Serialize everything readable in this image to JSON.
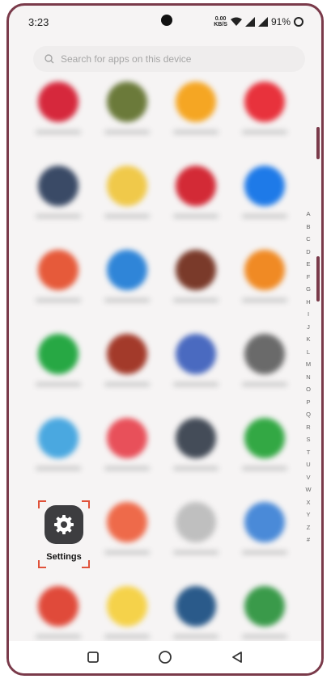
{
  "status_bar": {
    "time": "3:23",
    "net_speed_value": "0.00",
    "net_speed_unit": "KB/S",
    "battery": "91%"
  },
  "search": {
    "placeholder": "Search for apps on this device"
  },
  "settings_app": {
    "label": "Settings"
  },
  "alphabet_index": [
    "A",
    "B",
    "C",
    "D",
    "E",
    "F",
    "G",
    "H",
    "I",
    "J",
    "K",
    "L",
    "M",
    "N",
    "O",
    "P",
    "Q",
    "R",
    "S",
    "T",
    "U",
    "V",
    "W",
    "X",
    "Y",
    "Z",
    "#"
  ],
  "blurred_apps": [
    {
      "color": "#d6283c"
    },
    {
      "color": "#6b7a3a"
    },
    {
      "color": "#f5a623"
    },
    {
      "color": "#e8323c"
    },
    {
      "color": "#3a4a66"
    },
    {
      "color": "#f0c94a"
    },
    {
      "color": "#d32a36"
    },
    {
      "color": "#1e7ae8"
    },
    {
      "color": "#e65a3a"
    },
    {
      "color": "#2f85d8"
    },
    {
      "color": "#7a3a2a"
    },
    {
      "color": "#f08a24"
    },
    {
      "color": "#27a844"
    },
    {
      "color": "#a33a2a"
    },
    {
      "color": "#4a6ac0"
    },
    {
      "color": "#6a6a6a"
    },
    {
      "color": "#4aa8e0"
    },
    {
      "color": "#e8505a"
    },
    {
      "color": "#444c58"
    },
    {
      "color": "#33a844"
    },
    {
      "color": "#3d3d40"
    },
    {
      "color": "#ee6a4a"
    },
    {
      "color": "#bfbfbf"
    },
    {
      "color": "#4a8ad8"
    },
    {
      "color": "#e04a3a"
    },
    {
      "color": "#f5d24a"
    },
    {
      "color": "#2a5a8a"
    },
    {
      "color": "#3a9a4a"
    }
  ],
  "colors": {
    "frame": "#7a3a4a",
    "selection": "#e0523a"
  }
}
